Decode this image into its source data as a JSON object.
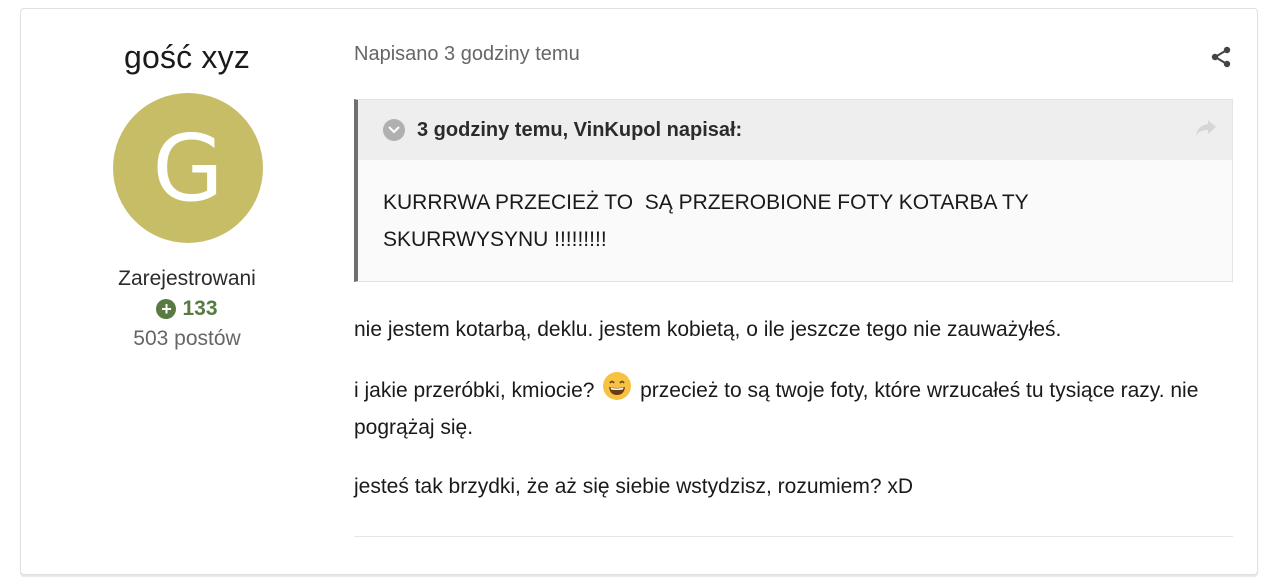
{
  "author": {
    "name": "gość xyz",
    "avatar_letter": "G",
    "avatar_color": "#c6bd66",
    "group": "Zarejestrowani",
    "reputation": "133",
    "reputation_color": "#597a43",
    "post_count": "503 postów"
  },
  "post": {
    "meta": "Napisano 3 godziny temu",
    "share_icon": "share-icon",
    "quote": {
      "citation": "3 godziny temu, VinKupol napisał:",
      "text": "KURRRWA PRZECIEŻ TO  SĄ PRZEROBIONE FOTY KOTARBA TY\nSKURRWYSYNU !!!!!!!!!"
    },
    "paragraphs": [
      {
        "text": "nie jestem kotarbą, deklu. jestem kobietą, o ile jeszcze tego nie zauważyłeś."
      },
      {
        "before": "i jakie przeróbki, kmiocie?",
        "emoji": "grinning-face-emoji",
        "after": "przecież to są twoje foty, które wrzucałeś tu tysiące razy. nie pogrążaj się."
      },
      {
        "text": "jesteś  tak brzydki, że aż się siebie wstydzisz, rozumiem? xD"
      }
    ]
  }
}
